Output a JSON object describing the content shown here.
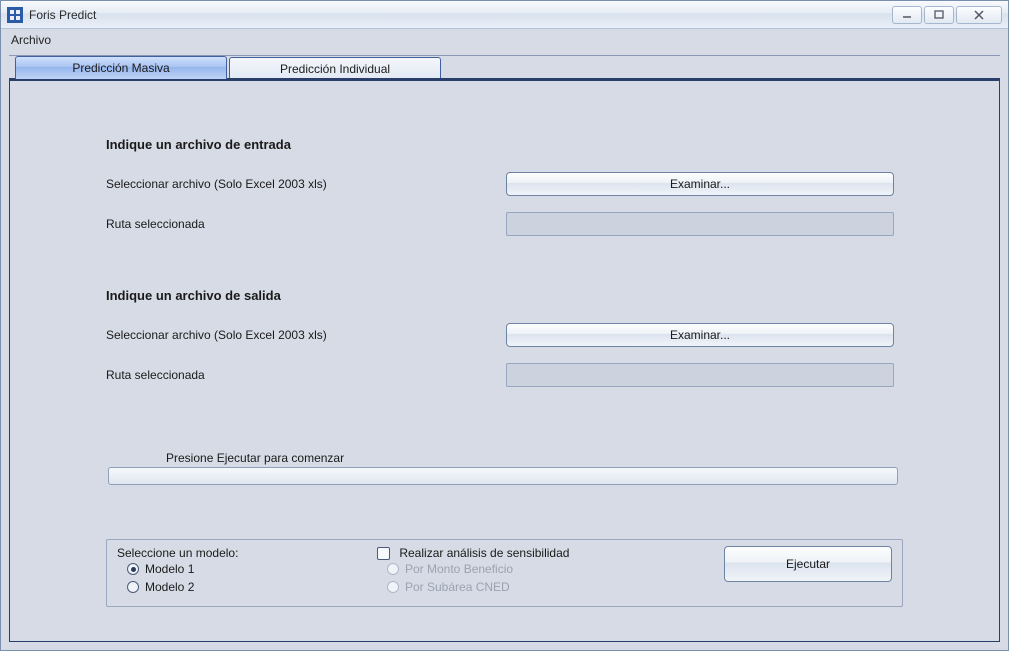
{
  "window": {
    "title": "Foris Predict"
  },
  "menu": {
    "file": "Archivo"
  },
  "tabs": {
    "masiva": "Predicción Masiva",
    "individual": "Predicción Individual"
  },
  "input_section": {
    "heading": "Indique un archivo de entrada",
    "select_label": "Seleccionar archivo (Solo Excel 2003 xls)",
    "browse": "Examinar...",
    "path_label": "Ruta seleccionada",
    "path_value": ""
  },
  "output_section": {
    "heading": "Indique un archivo de salida",
    "select_label": "Seleccionar archivo (Solo Excel 2003 xls)",
    "browse": "Examinar...",
    "path_label": "Ruta seleccionada",
    "path_value": ""
  },
  "progress": {
    "caption": "Presione Ejecutar para comenzar"
  },
  "model": {
    "heading": "Seleccione un modelo:",
    "option1": "Modelo 1",
    "option2": "Modelo 2"
  },
  "sensitivity": {
    "check_label": "Realizar análisis de sensibilidad",
    "by_monto": "Por Monto Beneficio",
    "by_subarea": "Por Subárea CNED"
  },
  "actions": {
    "execute": "Ejecutar"
  }
}
